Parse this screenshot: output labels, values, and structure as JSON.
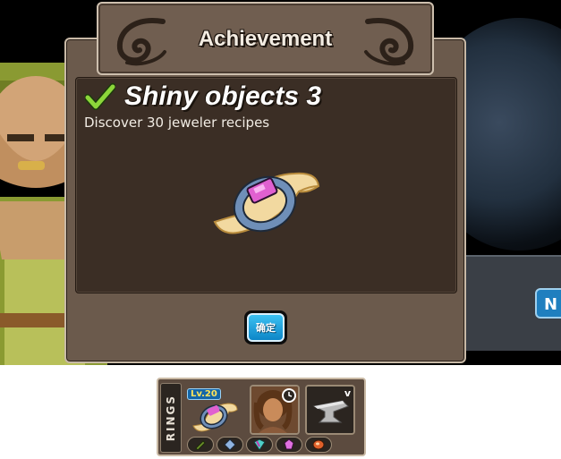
{
  "dialog": {
    "header_title": "Achievement",
    "achievement_name": "Shiny objects 3",
    "description": "Discover 30 jeweler recipes",
    "confirm_label": "确定"
  },
  "side_button_label": "N",
  "rings_bar": {
    "label": "RINGS",
    "level_badge": "Lv.20",
    "slot_toggle_glyph": "v",
    "gems": [
      "green-gem-icon",
      "blue-gem-icon",
      "crystal-gem-icon",
      "pink-gem-icon",
      "red-gem-icon"
    ]
  },
  "colors": {
    "panel": "#6b5a4c",
    "panel_inner": "#3b2e25",
    "border": "#c8b9a6",
    "button_blue": "#1a9fe0",
    "check_green": "#8cd63a"
  }
}
